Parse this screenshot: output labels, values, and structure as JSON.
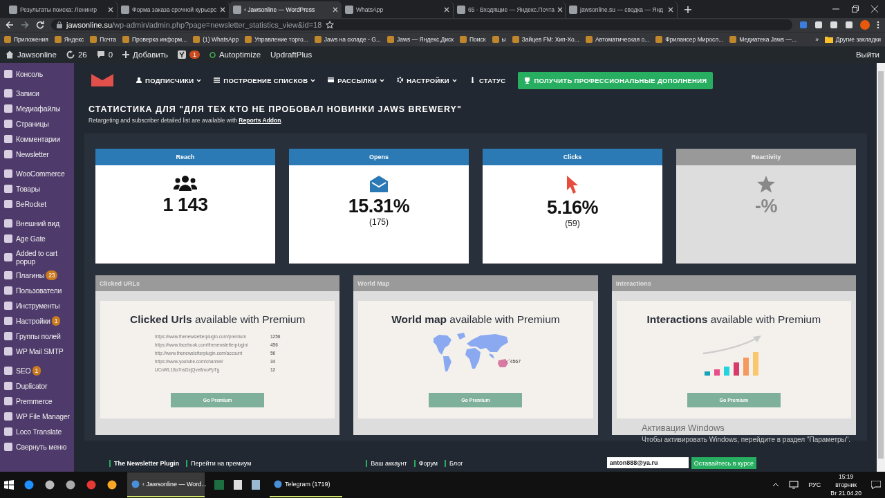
{
  "browser": {
    "tabs": [
      {
        "title": "Результаты поиска: Ленингр",
        "selected": false
      },
      {
        "title": "Форма заказа срочной курьерс",
        "selected": false
      },
      {
        "title": "‹ Jawsonline — WordPress",
        "selected": true
      },
      {
        "title": "WhatsApp",
        "selected": false
      },
      {
        "title": "65 · Входящие — Яндекс.Почта",
        "selected": false
      },
      {
        "title": "jawsonline.su — сводка — Янд",
        "selected": false
      }
    ],
    "url_host": "jawsonline.su",
    "url_path": "/wp-admin/admin.php?page=newsletter_statistics_view&id=18",
    "bookmarks": [
      "Приложения",
      "Яндекс",
      "Почта",
      "Проверка информ...",
      "(1) WhatsApp",
      "Управление торго...",
      "Jaws на складе - G...",
      "Jaws — Яндекс.Диск",
      "Поиск",
      "ы",
      "Зайцев FM: Хип-Хо...",
      "Автоматическая о...",
      "Фрилансер Миросл...",
      "Медиатека Jaws —..."
    ],
    "bookmarks_more": "»",
    "other_bookmarks": "Другие закладки"
  },
  "admin_bar": {
    "site": "Jawsonline",
    "updates": "26",
    "comments": "0",
    "add": "Добавить",
    "seo_badge": "1",
    "items": [
      "Autoptimize",
      "UpdraftPlus"
    ],
    "logout": "Выйти"
  },
  "sidebar": {
    "groups": [
      [
        {
          "label": "Консоль"
        }
      ],
      [
        {
          "label": "Записи"
        },
        {
          "label": "Медиафайлы"
        },
        {
          "label": "Страницы"
        },
        {
          "label": "Комментарии"
        },
        {
          "label": "Newsletter"
        }
      ],
      [
        {
          "label": "WooCommerce"
        },
        {
          "label": "Товары"
        },
        {
          "label": "BeRocket"
        }
      ],
      [
        {
          "label": "Внешний вид"
        },
        {
          "label": "Age Gate"
        },
        {
          "label": "Added to cart popup"
        },
        {
          "label": "Плагины",
          "badge": "23"
        },
        {
          "label": "Пользователи"
        },
        {
          "label": "Инструменты"
        },
        {
          "label": "Настройки",
          "badge": "1"
        },
        {
          "label": "Группы полей"
        },
        {
          "label": "WP Mail SMTP"
        }
      ],
      [
        {
          "label": "SEO",
          "badge": "1"
        },
        {
          "label": "Duplicator"
        },
        {
          "label": "Premmerce"
        },
        {
          "label": "WP File Manager"
        },
        {
          "label": "Loco Translate"
        },
        {
          "label": "Свернуть меню"
        }
      ]
    ]
  },
  "plugin_nav": {
    "items": [
      {
        "label": "ПОДПИСЧИКИ",
        "has_menu": true
      },
      {
        "label": "ПОСТРОЕНИЕ СПИСКОВ",
        "has_menu": true
      },
      {
        "label": "РАССЫЛКИ",
        "has_menu": true
      },
      {
        "label": "НАСТРОЙКИ",
        "has_menu": true
      },
      {
        "label": "СТАТУС",
        "has_menu": false
      }
    ],
    "pro_button": "ПОЛУЧИТЬ ПРОФЕССИОНАЛЬНЫЕ ДОПОЛНЕНИЯ"
  },
  "heading": "СТАТИСТИКА ДЛЯ \"ДЛЯ ТЕХ КТО НЕ ПРОБОВАЛ НОВИНКИ JAWS BREWERY\"",
  "subheading": {
    "text": "Retargeting and subscriber detailed list are available with ",
    "link": "Reports Addon",
    "after": "."
  },
  "stats": [
    {
      "title": "Reach",
      "value": "1 143",
      "disabled": false
    },
    {
      "title": "Opens",
      "value": "15.31%",
      "count": "(175)",
      "disabled": false
    },
    {
      "title": "Clicks",
      "value": "5.16%",
      "count": "(59)",
      "disabled": false
    },
    {
      "title": "Reactivity",
      "value": "-%",
      "disabled": true
    }
  ],
  "panels": [
    {
      "kind": "urls",
      "title": "Clicked URLs",
      "headline": "**Clicked Urls** available with Premium",
      "rows": [
        {
          "url": "https://www.thenewsletterplugin.com/premium",
          "count": "1256"
        },
        {
          "url": "https://www.facebook.com/thenewsletterplugin/",
          "count": "456"
        },
        {
          "url": "http://www.thenewsletterplugin.com/account",
          "count": "56"
        },
        {
          "url": "https://www.youtube.com/channel/",
          "count": "34"
        },
        {
          "url": "UCnWL18o7nsDzjQve8moPpTg",
          "count": "12"
        }
      ],
      "button": "Go Premium"
    },
    {
      "kind": "map",
      "title": "World Map",
      "headline": "**World map** available with Premium",
      "map_label": "4567",
      "button": "Go Premium"
    },
    {
      "kind": "chart",
      "title": "Interactions",
      "headline": "**Interactions** available with Premium",
      "button": "Go Premium"
    }
  ],
  "footer": {
    "links": [
      [
        {
          "label": "The Newsletter Plugin",
          "strong": true
        },
        {
          "label": "Перейти на премиум",
          "strong": false
        }
      ],
      [
        {
          "label": "Ваш аккаунт",
          "strong": false
        },
        {
          "label": "Форум",
          "strong": false
        },
        {
          "label": "Блог",
          "strong": false
        }
      ]
    ],
    "email": "anton888@ya.ru",
    "subscribe": "Оставайтесь в курсе"
  },
  "windows_notice": {
    "title": "Активация Windows",
    "text": "Чтобы активировать Windows, перейдите в раздел \"Параметры\"."
  },
  "taskbar": {
    "windows": [
      {
        "title": "‹ Jawsonline — Word...",
        "selected": true
      },
      {
        "title": "Telegram (1719)",
        "selected": false
      }
    ],
    "language": "РУС",
    "time": "15:19",
    "weekday": "вторник",
    "date": "Вт 21.04.20"
  }
}
